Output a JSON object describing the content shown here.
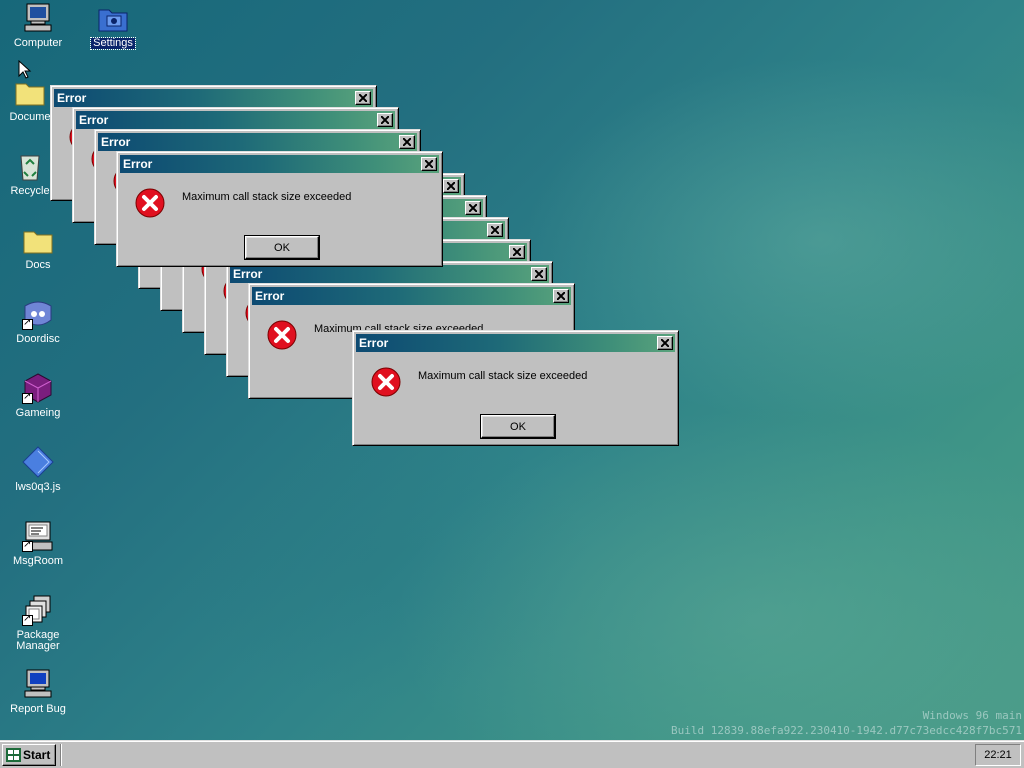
{
  "desktop": {
    "icons": [
      {
        "label": "Computer",
        "icon": "computer-icon"
      },
      {
        "label": "Settings",
        "icon": "settings-folder-icon",
        "selected": true
      },
      {
        "label": "Documents",
        "icon": "folder-icon"
      },
      {
        "label": "Recycle Bin",
        "icon": "recycle-bin-icon"
      },
      {
        "label": "Docs",
        "icon": "folder-icon"
      },
      {
        "label": "Doordisc",
        "icon": "doordisc-icon"
      },
      {
        "label": "Gameing",
        "icon": "game-cube-icon"
      },
      {
        "label": "lws0q3.js",
        "icon": "js-file-icon"
      },
      {
        "label": "MsgRoom",
        "icon": "msgroom-icon"
      },
      {
        "label": "Package Manager",
        "icon": "package-manager-icon"
      },
      {
        "label": "Report Bug",
        "icon": "report-bug-icon"
      }
    ],
    "visible_labels": {
      "computer": "Computer",
      "settings": "Settings",
      "documents": "Docume",
      "recycle": "Recycle",
      "docs": "Docs",
      "doordisc": "Doordisc",
      "gameing": "Gameing",
      "jsfile": "lws0q3.js",
      "msgroom": "MsgRoom",
      "package_line1": "Package",
      "package_line2": "Manager",
      "reportbug": "Report Bug"
    }
  },
  "error_dialog": {
    "title": "Error",
    "message": "Maximum call stack size exceeded",
    "ok_label": "OK",
    "icon": "error-icon",
    "stack_count": 11
  },
  "watermark": {
    "line1": "Windows 96 main",
    "line2": "Build 12839.88efa922.230410-1942.d77c73edcc428f7bc571"
  },
  "taskbar": {
    "start_label": "Start",
    "clock": "22:21"
  },
  "colors": {
    "titlebar_start": "#0d4a72",
    "titlebar_end": "#5aa37c",
    "error_red": "#e01020",
    "window_face": "#c0c0c0"
  }
}
